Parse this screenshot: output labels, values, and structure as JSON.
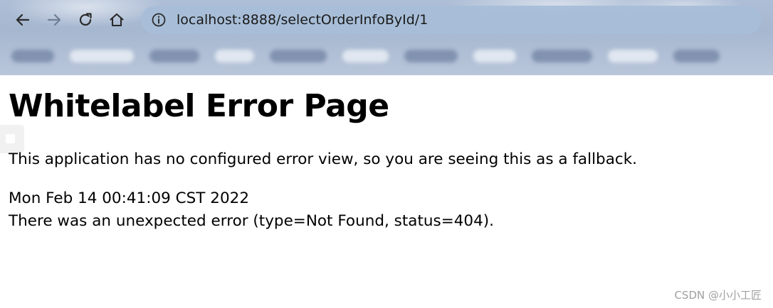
{
  "browser": {
    "url": "localhost:8888/selectOrderInfoById/1",
    "nav_icons": [
      "back-arrow-icon",
      "forward-arrow-icon",
      "reload-icon",
      "home-icon",
      "info-icon"
    ]
  },
  "page": {
    "title": "Whitelabel Error Page",
    "message": "This application has no configured error view, so you are seeing this as a fallback.",
    "timestamp": "Mon Feb 14 00:41:09 CST 2022",
    "error": "There was an unexpected error (type=Not Found, status=404)."
  },
  "watermark": {
    "text": "CSDN @小小工匠"
  },
  "colors": {
    "chrome": "#a6b7d0",
    "address_bar": "#a8bed8",
    "background": "#ffffff",
    "text": "#000000",
    "watermark": "#a0a0a0"
  }
}
